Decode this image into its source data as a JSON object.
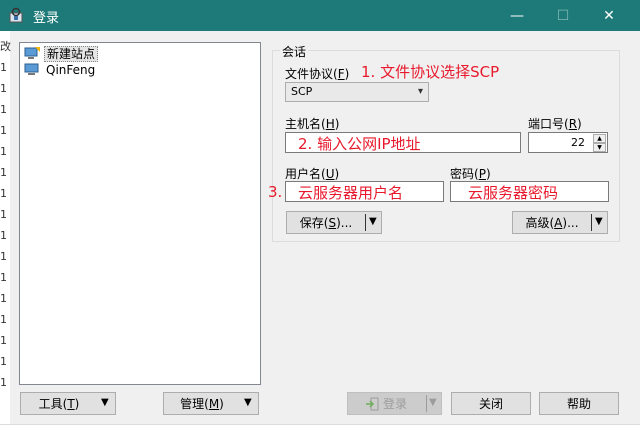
{
  "window": {
    "title": "登录",
    "minimize": "—",
    "maximize": "☐",
    "close": "✕"
  },
  "background_chars": [
    "改",
    "1",
    "1",
    "1",
    "1",
    "1",
    "1",
    "1",
    "1",
    "1",
    "1",
    "1",
    "1",
    "1",
    "1",
    "1",
    "1"
  ],
  "sites": [
    {
      "label": "新建站点",
      "selected": true
    },
    {
      "label": "QinFeng",
      "selected": false
    }
  ],
  "session": {
    "group_title": "会话",
    "protocol": {
      "label": "文件协议(",
      "key": "F",
      "label_end": ")",
      "value": "SCP",
      "annotation": "1. 文件协议选择SCP"
    },
    "host": {
      "label": "主机名(",
      "key": "H",
      "label_end": ")",
      "annotation": "2. 输入公网IP地址"
    },
    "port": {
      "label": "端口号(",
      "key": "R",
      "label_end": ")",
      "value": "22"
    },
    "user": {
      "label": "用户名(",
      "key": "U",
      "label_end": ")",
      "annotation_num": "3.",
      "annotation": "云服务器用户名"
    },
    "password": {
      "label": "密码(",
      "key": "P",
      "label_end": ")",
      "annotation": "云服务器密码"
    },
    "save": {
      "label": "保存(",
      "key": "S",
      "label_end": ")..."
    },
    "advanced": {
      "label": "高级(",
      "key": "A",
      "label_end": ")..."
    }
  },
  "bottom": {
    "tools": {
      "label": "工具(",
      "key": "T",
      "label_end": ")"
    },
    "manage": {
      "label": "管理(",
      "key": "M",
      "label_end": ")"
    },
    "login": "登录",
    "close": "关闭",
    "help": "帮助"
  },
  "colors": {
    "titlebar": "#1e7a78",
    "annotation": "#e8192c"
  }
}
